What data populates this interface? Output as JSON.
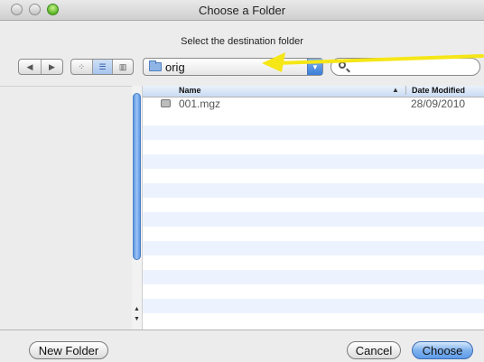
{
  "window": {
    "title": "Choose a Folder"
  },
  "dialog": {
    "subtitle": "Select the destination folder"
  },
  "toolbar": {
    "back_icon": "◀",
    "forward_icon": "▶",
    "view_icon_glyph": "⁘",
    "view_list_glyph": "☰",
    "view_column_glyph": "▥",
    "location": "orig",
    "search_placeholder": ""
  },
  "list": {
    "columns": {
      "name": "Name",
      "sort_indicator": "▲",
      "date": "Date Modified"
    },
    "rows": [
      {
        "name": "001.mgz",
        "date": "28/09/2010"
      }
    ]
  },
  "scroll": {
    "up": "▲",
    "down": "▼"
  },
  "buttons": {
    "new_folder": "New Folder",
    "cancel": "Cancel",
    "choose": "Choose"
  },
  "annotation": {
    "arrow_color": "#f5e616"
  },
  "colors": {
    "accent": "#5d9be8",
    "row_alt": "#edf3fe"
  }
}
